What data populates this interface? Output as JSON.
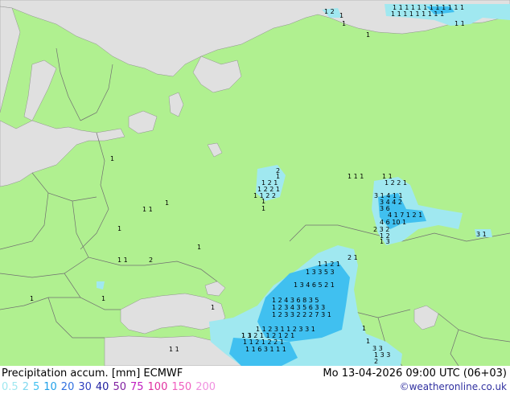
{
  "footer": {
    "title": "Precipitation accum. [mm] ECMWF",
    "datetime": "Mo 13-04-2026 09:00 UTC (06+03)",
    "credit": "©weatheronline.co.uk"
  },
  "legend": [
    {
      "label": "0.5",
      "color": "#a0e8f0"
    },
    {
      "label": "2",
      "color": "#80d8f0"
    },
    {
      "label": "5",
      "color": "#40c0f0"
    },
    {
      "label": "10",
      "color": "#20a0e8"
    },
    {
      "label": "20",
      "color": "#3070e0"
    },
    {
      "label": "30",
      "color": "#3040c0"
    },
    {
      "label": "40",
      "color": "#2020a0"
    },
    {
      "label": "50",
      "color": "#8020a0"
    },
    {
      "label": "75",
      "color": "#c020c0"
    },
    {
      "label": "100",
      "color": "#e030a0"
    },
    {
      "label": "150",
      "color": "#f060c0"
    },
    {
      "label": "200",
      "color": "#f090e0"
    }
  ],
  "map_colors": {
    "land": "#b0f090",
    "sea": "#e0e0e0",
    "border": "#707070",
    "precip_light": "#a0e8f0",
    "precip_medium": "#40c0f0"
  },
  "map_labels": {
    "north_cluster": [
      "1 2",
      "1",
      "1",
      "1 1 1 1 1 1 1 1 1 1 1 1",
      "1 1 1 1 1 1 1 1 1",
      "1 1",
      "1"
    ],
    "central_cluster": [
      "2",
      "1",
      "1 2 1",
      "1 2 2 1",
      "1 1 2 2",
      "1",
      "1"
    ],
    "east_cluster": [
      "1 1 1",
      "1 1",
      "1 2 2 1",
      "3 1 4 1 1",
      "3 4 4 2",
      "3 6",
      "4 1 7 1 2 1",
      "4 6 10 1",
      "2 3 2",
      "1 2",
      "1 3",
      "3 1"
    ],
    "west_values": [
      "1",
      "1 1",
      "1",
      "1",
      "1 1",
      "2",
      "1",
      "1",
      "1"
    ],
    "caucasus_cluster": [
      "2 1",
      "1 1 2 1",
      "1 3 3 5 3",
      "1 3 4 6 5 2 1",
      "1 2 4 3 6 8 3 5",
      "1 2 3 4 3 5 6 3 3",
      "1 2 3 3 2 2 2 7 3 1",
      "1 1 2 3 1 1 2 3 3 1",
      "1 3 2 1 1 2 1 2 1",
      "1 1 2 1 2 2 1",
      "1 1 6 3 1 1 1",
      "1 1"
    ],
    "south_values": [
      "1",
      "1 1",
      "1",
      "1",
      "3 3",
      "1 3 3",
      "2"
    ]
  }
}
